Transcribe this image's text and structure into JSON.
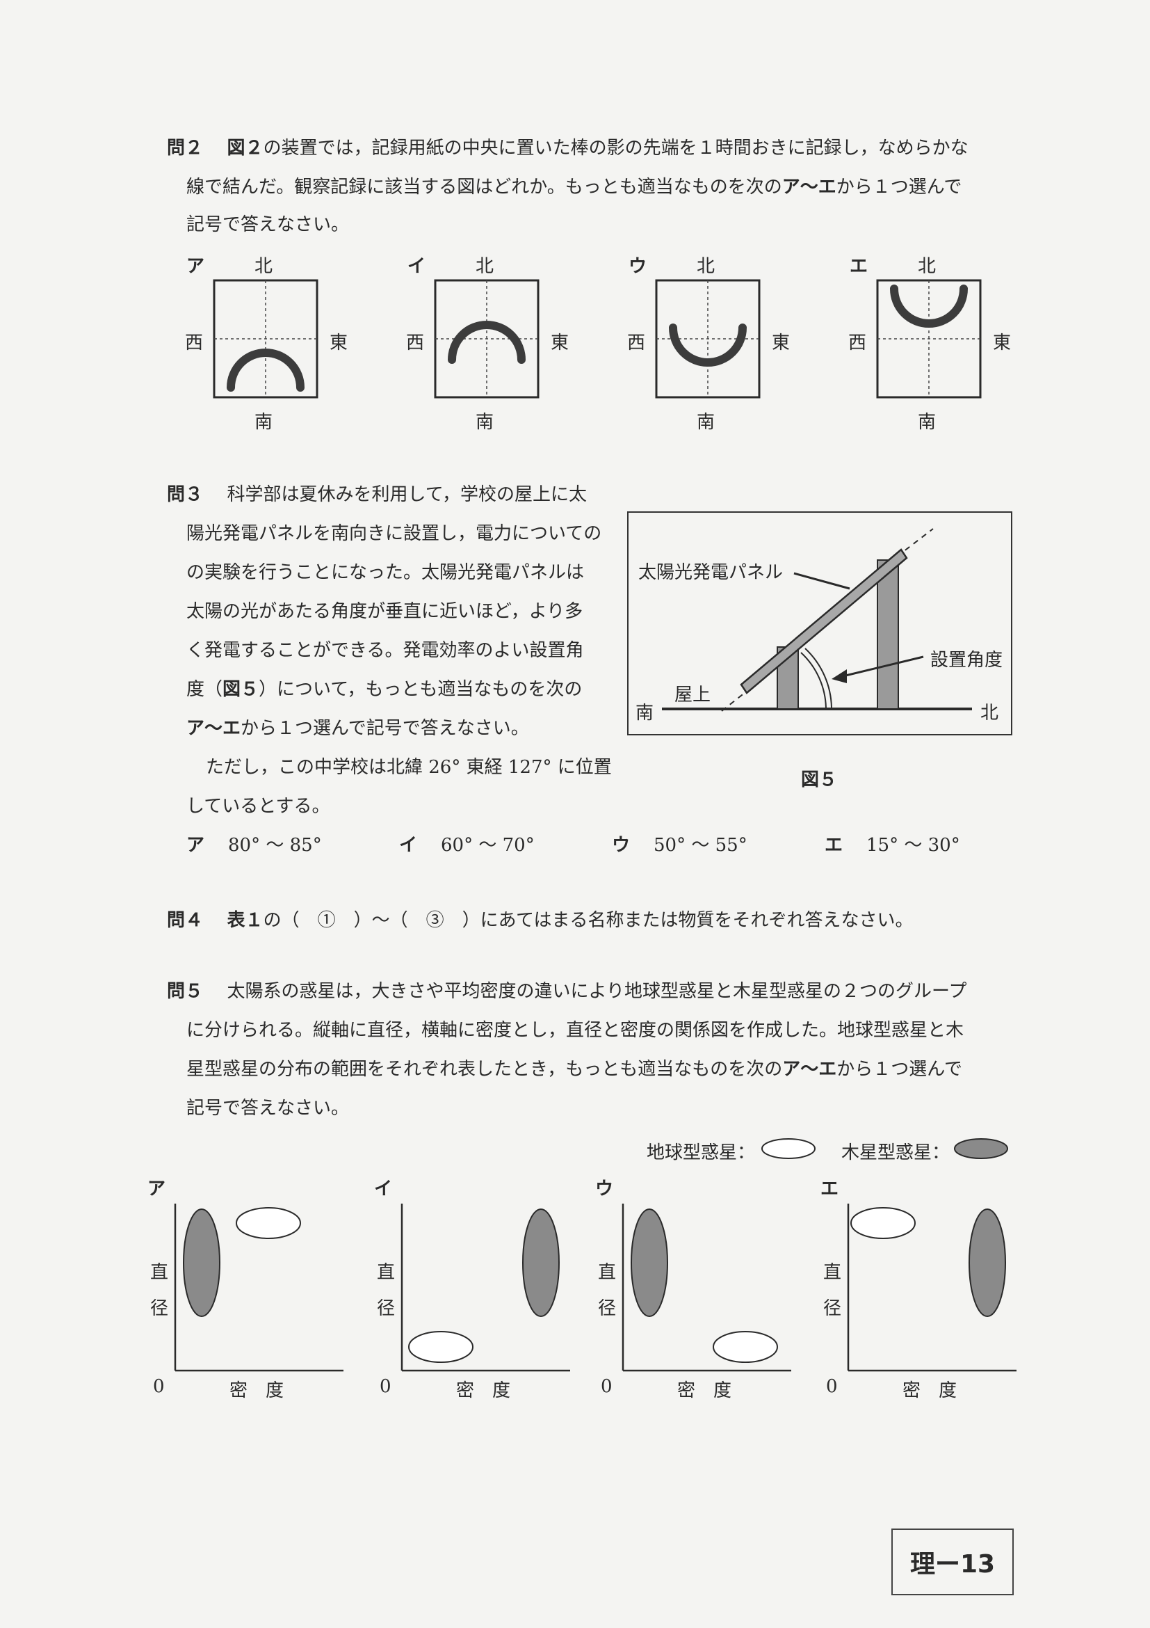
{
  "q2": {
    "num": "問２",
    "line1_a": "図２",
    "line1_b": "の装置では，記録用紙の中央に置いた棒の影の先端を１時間おきに記録し，なめらかな",
    "line2_a": "線で結んだ。観察記録に該当する図はどれか。もっとも適当なものを次の",
    "line2_b": "ア〜エ",
    "line2_c": "から１つ選んで",
    "line3": "記号で答えなさい。",
    "options": [
      {
        "label": "ア",
        "north": "北",
        "south": "南",
        "west": "西",
        "east": "東",
        "arc": "bottom-arch"
      },
      {
        "label": "イ",
        "north": "北",
        "south": "南",
        "west": "西",
        "east": "東",
        "arc": "center-arch"
      },
      {
        "label": "ウ",
        "north": "北",
        "south": "南",
        "west": "西",
        "east": "東",
        "arc": "center-bowl"
      },
      {
        "label": "エ",
        "north": "北",
        "south": "南",
        "west": "西",
        "east": "東",
        "arc": "top-bowl"
      }
    ]
  },
  "q3": {
    "num": "問３",
    "lines": [
      "科学部は夏休みを利用して，学校の屋上に太",
      "陽光発電パネルを南向きに設置し，電力についての",
      "の実験を行うことになった。太陽光発電パネルは",
      "太陽の光があたる角度が垂直に近いほど，より多",
      "く発電することができる。発電効率のよい設置角"
    ],
    "line6_a": "度（",
    "line6_b": "図５",
    "line6_c": "）について，もっとも適当なものを次の",
    "line7_a": "ア〜エ",
    "line7_b": "から１つ選んで記号で答えなさい。",
    "line8": "ただし，この中学校は北緯 26° 東経 127° に位置",
    "line9": "しているとする。",
    "figure": {
      "panel_label": "太陽光発電パネル",
      "angle_label": "設置角度",
      "roof_label": "屋上",
      "south": "南",
      "north": "北",
      "caption": "図５"
    },
    "choices": [
      {
        "label": "ア",
        "text": "80° 〜 85°"
      },
      {
        "label": "イ",
        "text": "60° 〜 70°"
      },
      {
        "label": "ウ",
        "text": "50° 〜 55°"
      },
      {
        "label": "エ",
        "text": "15° 〜 30°"
      }
    ]
  },
  "q4": {
    "num": "問４",
    "a": "表１",
    "b": "の（　①　）〜（　③　）にあてはまる名称または物質をそれぞれ答えなさい。"
  },
  "q5": {
    "num": "問５",
    "line1": "太陽系の惑星は，大きさや平均密度の違いにより地球型惑星と木星型惑星の２つのグループ",
    "line2": "に分けられる。縦軸に直径，横軸に密度とし，直径と密度の関係図を作成した。地球型惑星と木",
    "line3_a": "星型惑星の分布の範囲をそれぞれ表したとき，もっとも適当なものを次の",
    "line3_b": "ア〜エ",
    "line3_c": "から１つ選んで",
    "line4": "記号で答えなさい。",
    "legend_terrestrial": "地球型惑星：",
    "legend_jovian": "木星型惑星：",
    "y_label_1": "直",
    "y_label_2": "径",
    "x_label": "密　度",
    "origin": "0",
    "graphs": [
      {
        "label": "ア",
        "jovian": "low-density-large",
        "terrestrial": "high-density-large"
      },
      {
        "label": "イ",
        "jovian": "high-density-large",
        "terrestrial": "low-density-small"
      },
      {
        "label": "ウ",
        "jovian": "low-density-large",
        "terrestrial": "high-density-small"
      },
      {
        "label": "エ",
        "jovian": "high-density-large",
        "terrestrial": "low-density-large"
      }
    ]
  },
  "page_label": "理ー13",
  "colors": {
    "ink": "#2a2a2a",
    "shadow_arc": "#3c3c3c",
    "gray_fill": "#8a8a8a",
    "paper": "#f4f4f2"
  }
}
